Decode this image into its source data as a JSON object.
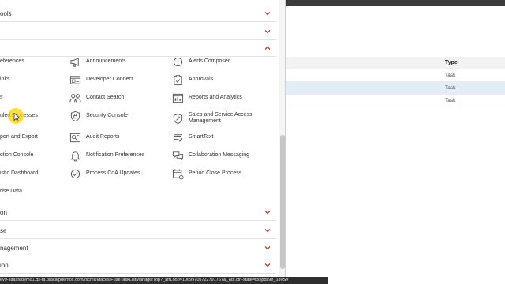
{
  "background_table": {
    "type_header": "Type",
    "rows": [
      "Task",
      "Task",
      "Task"
    ]
  },
  "navigator": {
    "sections_top": [
      {
        "label": "ools"
      },
      {
        "label": ""
      },
      {
        "label": ""
      }
    ],
    "grid": {
      "col0": [
        "eferences",
        "inks",
        "s",
        "uled Processes",
        "port and Export",
        "ction Console",
        "istic Dashboard",
        "rise Data"
      ],
      "col1": [
        "Announcements",
        "Developer Connect",
        "Contact Search",
        "Security Console",
        "Audit Reports",
        "Notification Preferences",
        "Process CoA Updates"
      ],
      "col2": [
        "Alerts Composer",
        "Approvals",
        "Reports and Analytics",
        "Sales and Service Access Management",
        "SmartText",
        "Collaboration Messaging",
        "Period Close Process"
      ]
    },
    "sections_bottom": [
      {
        "label": "on"
      },
      {
        "label": "se"
      },
      {
        "label": "nagement"
      },
      {
        "label": "ion"
      }
    ]
  },
  "status_bar": {
    "url": "ev9-saasfademo1.ds-fa.oraclepdemos.com/fscmUI/faces/FuseTaskListManagerTop?_afrLoop=10699705722791767&_adf.ctrl-state=kstlpds9e_130S#"
  },
  "colors": {
    "chevron": "#b0412e",
    "cursor_highlight": "#ffd600",
    "selected_row": "#e3edf8"
  }
}
